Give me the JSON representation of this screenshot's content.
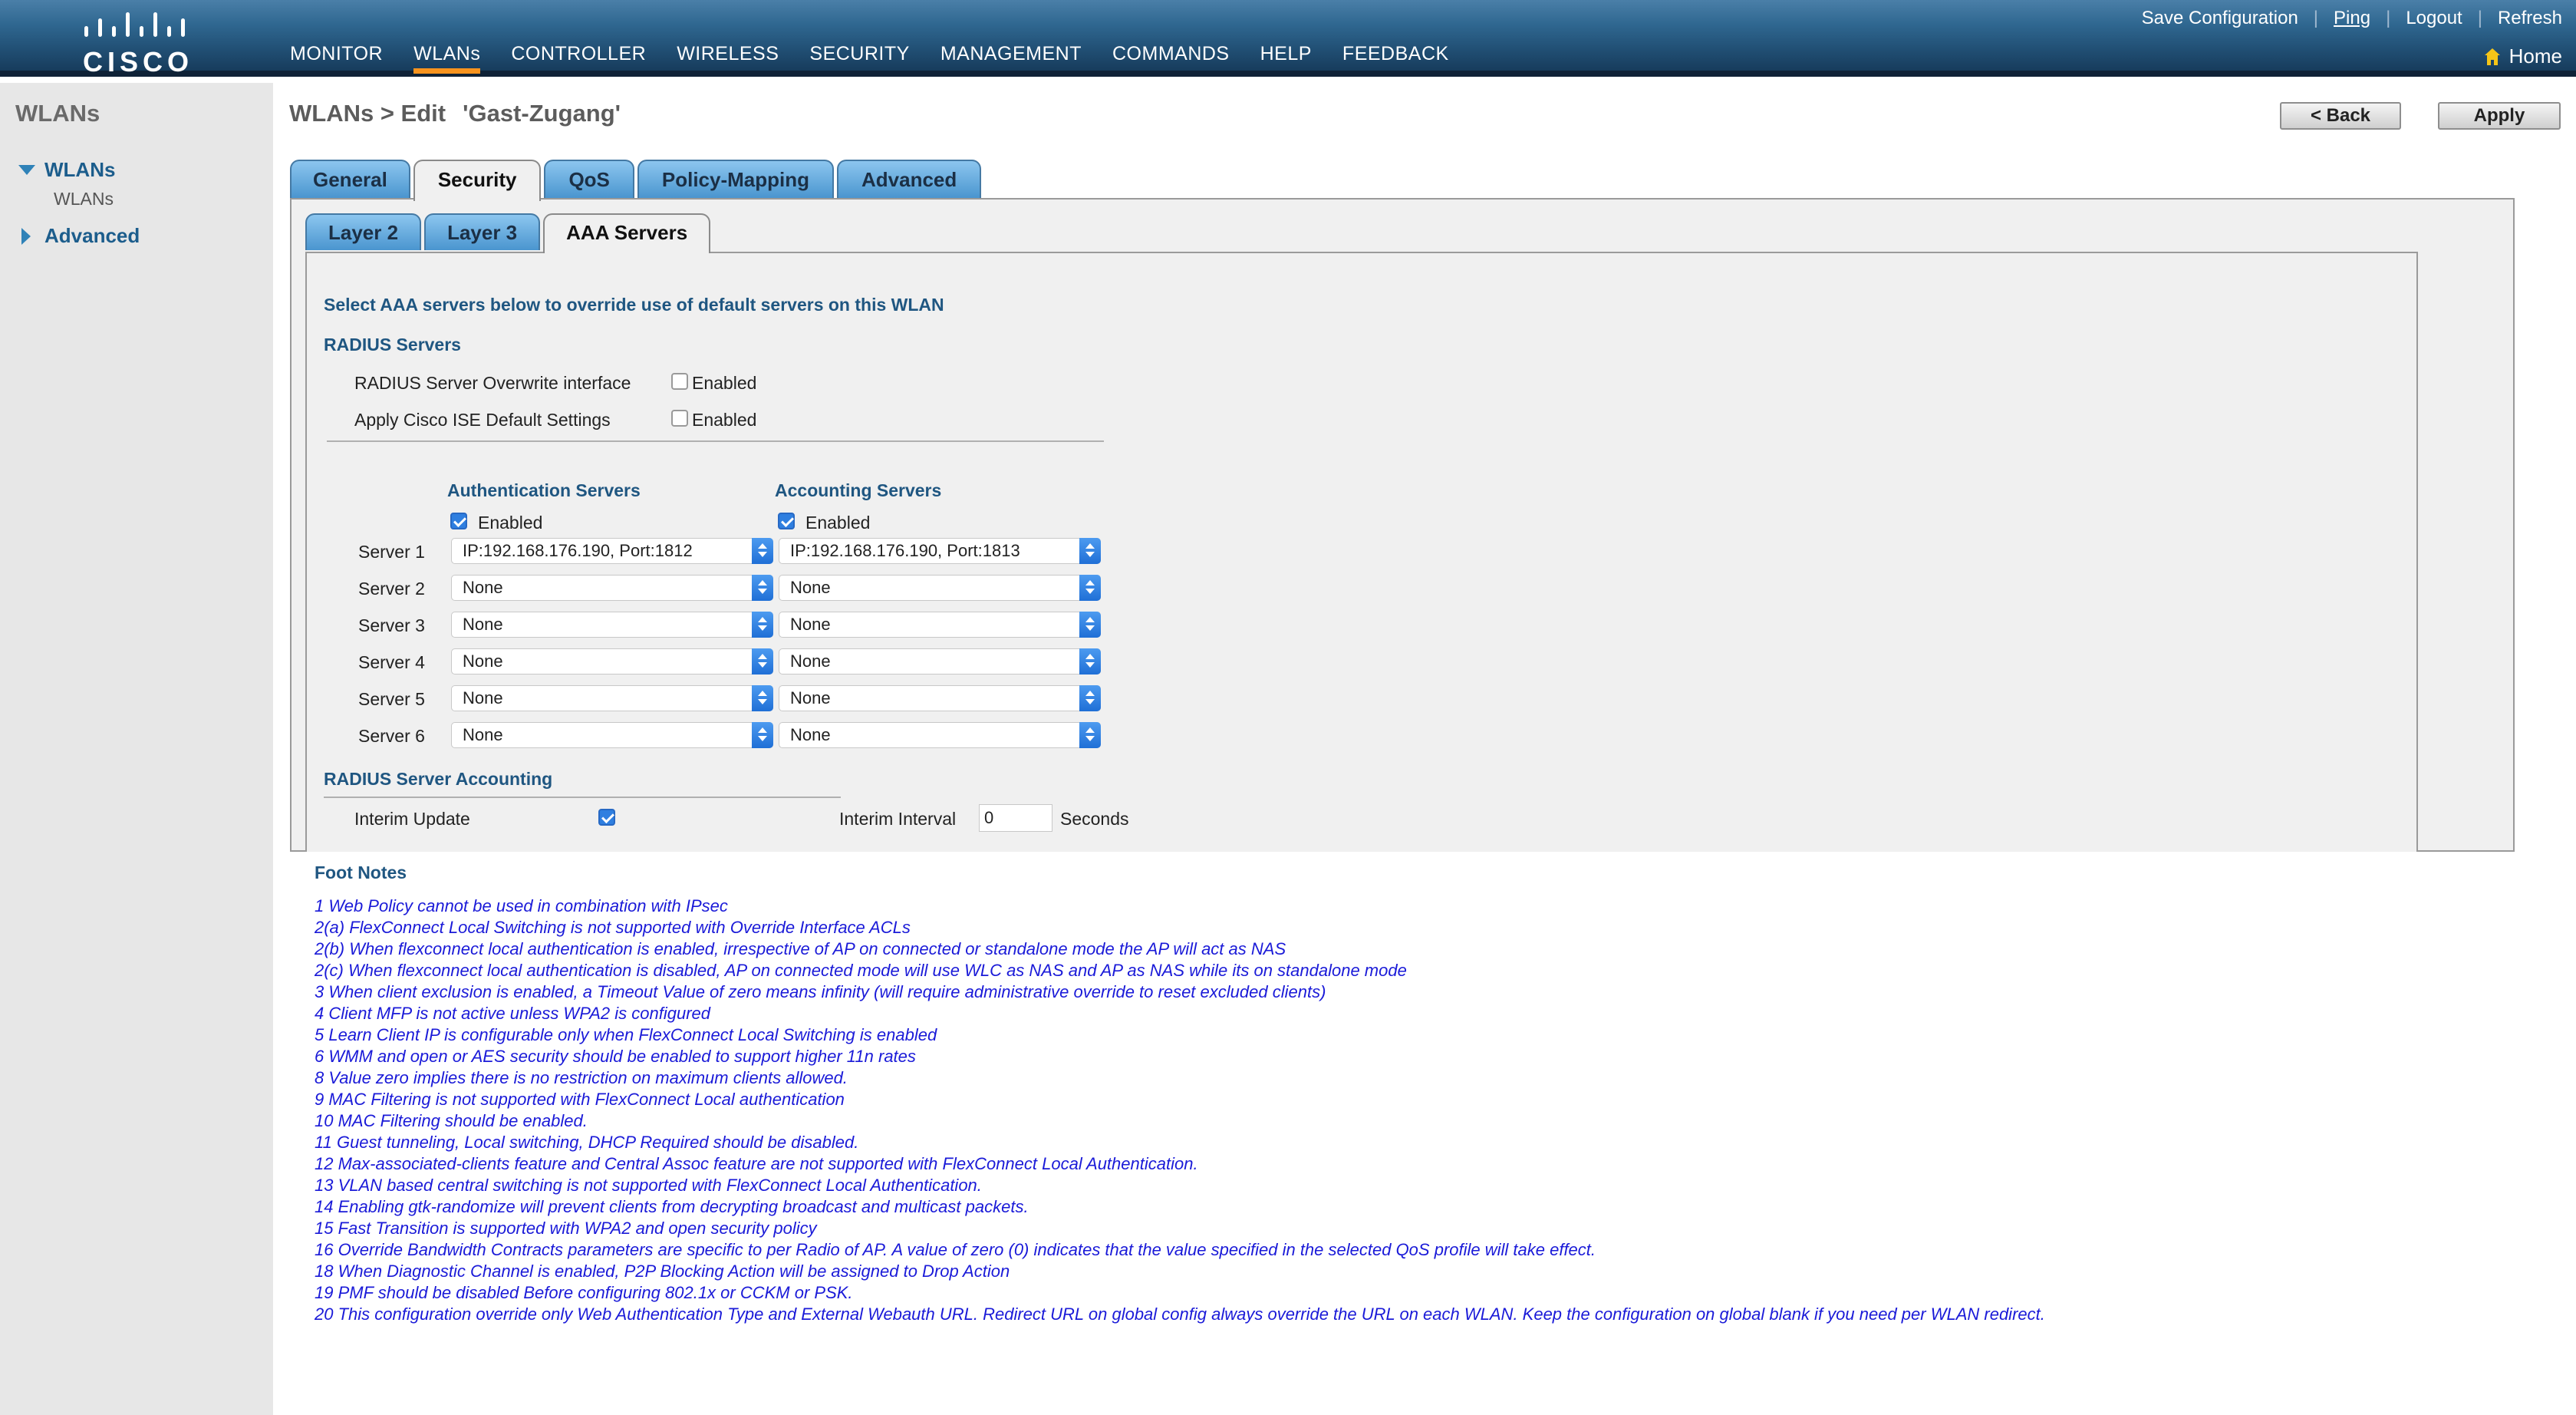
{
  "header": {
    "brand": "CISCO",
    "nav": [
      "MONITOR",
      "WLANs",
      "CONTROLLER",
      "WIRELESS",
      "SECURITY",
      "MANAGEMENT",
      "COMMANDS",
      "HELP",
      "FEEDBACK"
    ],
    "active_nav": "WLANs",
    "links": [
      "Save Configuration",
      "Ping",
      "Logout",
      "Refresh"
    ],
    "home": "Home"
  },
  "sidebar": {
    "title": "WLANs",
    "items": [
      {
        "label": "WLANs",
        "sub": "WLANs"
      },
      {
        "label": "Advanced"
      }
    ]
  },
  "page": {
    "title": "WLANs > Edit",
    "wlan_name": "'Gast-Zugang'",
    "back_label": "< Back",
    "apply_label": "Apply"
  },
  "tabs": [
    "General",
    "Security",
    "QoS",
    "Policy-Mapping",
    "Advanced"
  ],
  "active_tab": "Security",
  "subtabs": [
    "Layer 2",
    "Layer 3",
    "AAA Servers"
  ],
  "active_subtab": "AAA Servers",
  "aaa": {
    "intro": "Select AAA servers below to override use of default servers on this WLAN",
    "radius_heading": "RADIUS Servers",
    "overwrite_label": "RADIUS Server Overwrite interface",
    "overwrite_enabled": false,
    "ise_label": "Apply Cisco ISE Default Settings",
    "ise_enabled": false,
    "enabled_label": "Enabled",
    "auth_heading": "Authentication Servers",
    "acct_heading": "Accounting Servers",
    "auth_enabled": true,
    "acct_enabled": true,
    "servers": [
      {
        "label": "Server 1",
        "auth": "IP:192.168.176.190, Port:1812",
        "acct": "IP:192.168.176.190, Port:1813"
      },
      {
        "label": "Server 2",
        "auth": "None",
        "acct": "None"
      },
      {
        "label": "Server 3",
        "auth": "None",
        "acct": "None"
      },
      {
        "label": "Server 4",
        "auth": "None",
        "acct": "None"
      },
      {
        "label": "Server 5",
        "auth": "None",
        "acct": "None"
      },
      {
        "label": "Server 6",
        "auth": "None",
        "acct": "None"
      }
    ],
    "accounting_heading": "RADIUS Server Accounting",
    "interim_update_label": "Interim Update",
    "interim_update": true,
    "interim_interval_label": "Interim Interval",
    "interim_interval_value": "0",
    "seconds_label": "Seconds"
  },
  "footnotes": {
    "title": "Foot Notes",
    "items": [
      "1 Web Policy cannot be used in combination with IPsec",
      "2(a) FlexConnect Local Switching is not supported with Override Interface ACLs",
      "2(b) When flexconnect local authentication is enabled, irrespective of AP on connected or standalone mode the AP will act as NAS",
      "2(c) When flexconnect local authentication is disabled, AP on connected mode will use WLC as NAS and AP as NAS while its on standalone mode",
      "3 When client exclusion is enabled, a Timeout Value of zero means infinity (will require administrative override to reset excluded clients)",
      "4 Client MFP is not active unless WPA2 is configured",
      "5 Learn Client IP is configurable only when FlexConnect Local Switching is enabled",
      "6 WMM and open or AES security should be enabled to support higher 11n rates",
      "8 Value zero implies there is no restriction on maximum clients allowed.",
      "9 MAC Filtering is not supported with FlexConnect Local authentication",
      "10 MAC Filtering should be enabled.",
      "11 Guest tunneling, Local switching, DHCP Required should be disabled.",
      "12 Max-associated-clients feature and Central Assoc feature are not supported with FlexConnect Local Authentication.",
      "13 VLAN based central switching is not supported with FlexConnect Local Authentication.",
      "14 Enabling gtk-randomize will prevent clients from decrypting broadcast and multicast packets.",
      "15 Fast Transition is supported with WPA2 and open security policy",
      "16 Override Bandwidth Contracts parameters are specific to per Radio of AP. A value of zero (0) indicates that the value specified in the selected QoS profile will take effect.",
      "18 When Diagnostic Channel is enabled, P2P Blocking Action will be assigned to Drop Action",
      "19 PMF should be disabled Before configuring 802.1x or CCKM or PSK.",
      "20 This configuration override only Web Authentication Type and External Webauth URL. Redirect URL on global config always override the URL on each WLAN. Keep the configuration on global blank if you need per WLAN redirect."
    ]
  },
  "colors": {
    "header_top": "#4a7fa8",
    "header_bottom": "#173c5c",
    "nav_active_underline": "#f7931e",
    "tab_blue": "#5fa6de",
    "heading_blue": "#1f5681",
    "footnote_blue": "#1a1ad8",
    "checkbox_blue": "#2f7fe0"
  },
  "icons": [
    "cisco-logo",
    "home-icon",
    "expand-triangle-icon",
    "collapse-triangle-icon",
    "checkbox",
    "select-caret-icon"
  ]
}
